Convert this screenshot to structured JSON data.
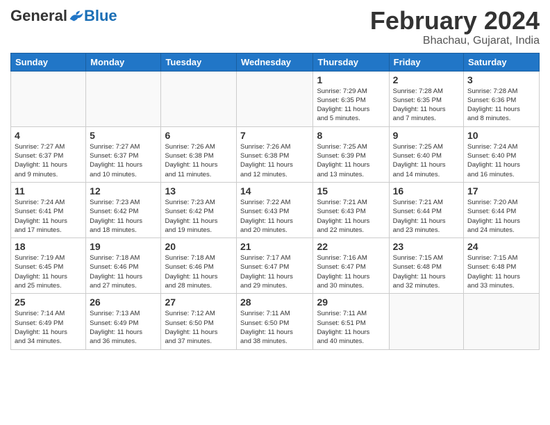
{
  "header": {
    "logo_general": "General",
    "logo_blue": "Blue",
    "title": "February 2024",
    "location": "Bhachau, Gujarat, India"
  },
  "days_of_week": [
    "Sunday",
    "Monday",
    "Tuesday",
    "Wednesday",
    "Thursday",
    "Friday",
    "Saturday"
  ],
  "weeks": [
    [
      {
        "day": "",
        "info": ""
      },
      {
        "day": "",
        "info": ""
      },
      {
        "day": "",
        "info": ""
      },
      {
        "day": "",
        "info": ""
      },
      {
        "day": "1",
        "info": "Sunrise: 7:29 AM\nSunset: 6:35 PM\nDaylight: 11 hours\nand 5 minutes."
      },
      {
        "day": "2",
        "info": "Sunrise: 7:28 AM\nSunset: 6:35 PM\nDaylight: 11 hours\nand 7 minutes."
      },
      {
        "day": "3",
        "info": "Sunrise: 7:28 AM\nSunset: 6:36 PM\nDaylight: 11 hours\nand 8 minutes."
      }
    ],
    [
      {
        "day": "4",
        "info": "Sunrise: 7:27 AM\nSunset: 6:37 PM\nDaylight: 11 hours\nand 9 minutes."
      },
      {
        "day": "5",
        "info": "Sunrise: 7:27 AM\nSunset: 6:37 PM\nDaylight: 11 hours\nand 10 minutes."
      },
      {
        "day": "6",
        "info": "Sunrise: 7:26 AM\nSunset: 6:38 PM\nDaylight: 11 hours\nand 11 minutes."
      },
      {
        "day": "7",
        "info": "Sunrise: 7:26 AM\nSunset: 6:38 PM\nDaylight: 11 hours\nand 12 minutes."
      },
      {
        "day": "8",
        "info": "Sunrise: 7:25 AM\nSunset: 6:39 PM\nDaylight: 11 hours\nand 13 minutes."
      },
      {
        "day": "9",
        "info": "Sunrise: 7:25 AM\nSunset: 6:40 PM\nDaylight: 11 hours\nand 14 minutes."
      },
      {
        "day": "10",
        "info": "Sunrise: 7:24 AM\nSunset: 6:40 PM\nDaylight: 11 hours\nand 16 minutes."
      }
    ],
    [
      {
        "day": "11",
        "info": "Sunrise: 7:24 AM\nSunset: 6:41 PM\nDaylight: 11 hours\nand 17 minutes."
      },
      {
        "day": "12",
        "info": "Sunrise: 7:23 AM\nSunset: 6:42 PM\nDaylight: 11 hours\nand 18 minutes."
      },
      {
        "day": "13",
        "info": "Sunrise: 7:23 AM\nSunset: 6:42 PM\nDaylight: 11 hours\nand 19 minutes."
      },
      {
        "day": "14",
        "info": "Sunrise: 7:22 AM\nSunset: 6:43 PM\nDaylight: 11 hours\nand 20 minutes."
      },
      {
        "day": "15",
        "info": "Sunrise: 7:21 AM\nSunset: 6:43 PM\nDaylight: 11 hours\nand 22 minutes."
      },
      {
        "day": "16",
        "info": "Sunrise: 7:21 AM\nSunset: 6:44 PM\nDaylight: 11 hours\nand 23 minutes."
      },
      {
        "day": "17",
        "info": "Sunrise: 7:20 AM\nSunset: 6:44 PM\nDaylight: 11 hours\nand 24 minutes."
      }
    ],
    [
      {
        "day": "18",
        "info": "Sunrise: 7:19 AM\nSunset: 6:45 PM\nDaylight: 11 hours\nand 25 minutes."
      },
      {
        "day": "19",
        "info": "Sunrise: 7:18 AM\nSunset: 6:46 PM\nDaylight: 11 hours\nand 27 minutes."
      },
      {
        "day": "20",
        "info": "Sunrise: 7:18 AM\nSunset: 6:46 PM\nDaylight: 11 hours\nand 28 minutes."
      },
      {
        "day": "21",
        "info": "Sunrise: 7:17 AM\nSunset: 6:47 PM\nDaylight: 11 hours\nand 29 minutes."
      },
      {
        "day": "22",
        "info": "Sunrise: 7:16 AM\nSunset: 6:47 PM\nDaylight: 11 hours\nand 30 minutes."
      },
      {
        "day": "23",
        "info": "Sunrise: 7:15 AM\nSunset: 6:48 PM\nDaylight: 11 hours\nand 32 minutes."
      },
      {
        "day": "24",
        "info": "Sunrise: 7:15 AM\nSunset: 6:48 PM\nDaylight: 11 hours\nand 33 minutes."
      }
    ],
    [
      {
        "day": "25",
        "info": "Sunrise: 7:14 AM\nSunset: 6:49 PM\nDaylight: 11 hours\nand 34 minutes."
      },
      {
        "day": "26",
        "info": "Sunrise: 7:13 AM\nSunset: 6:49 PM\nDaylight: 11 hours\nand 36 minutes."
      },
      {
        "day": "27",
        "info": "Sunrise: 7:12 AM\nSunset: 6:50 PM\nDaylight: 11 hours\nand 37 minutes."
      },
      {
        "day": "28",
        "info": "Sunrise: 7:11 AM\nSunset: 6:50 PM\nDaylight: 11 hours\nand 38 minutes."
      },
      {
        "day": "29",
        "info": "Sunrise: 7:11 AM\nSunset: 6:51 PM\nDaylight: 11 hours\nand 40 minutes."
      },
      {
        "day": "",
        "info": ""
      },
      {
        "day": "",
        "info": ""
      }
    ]
  ]
}
